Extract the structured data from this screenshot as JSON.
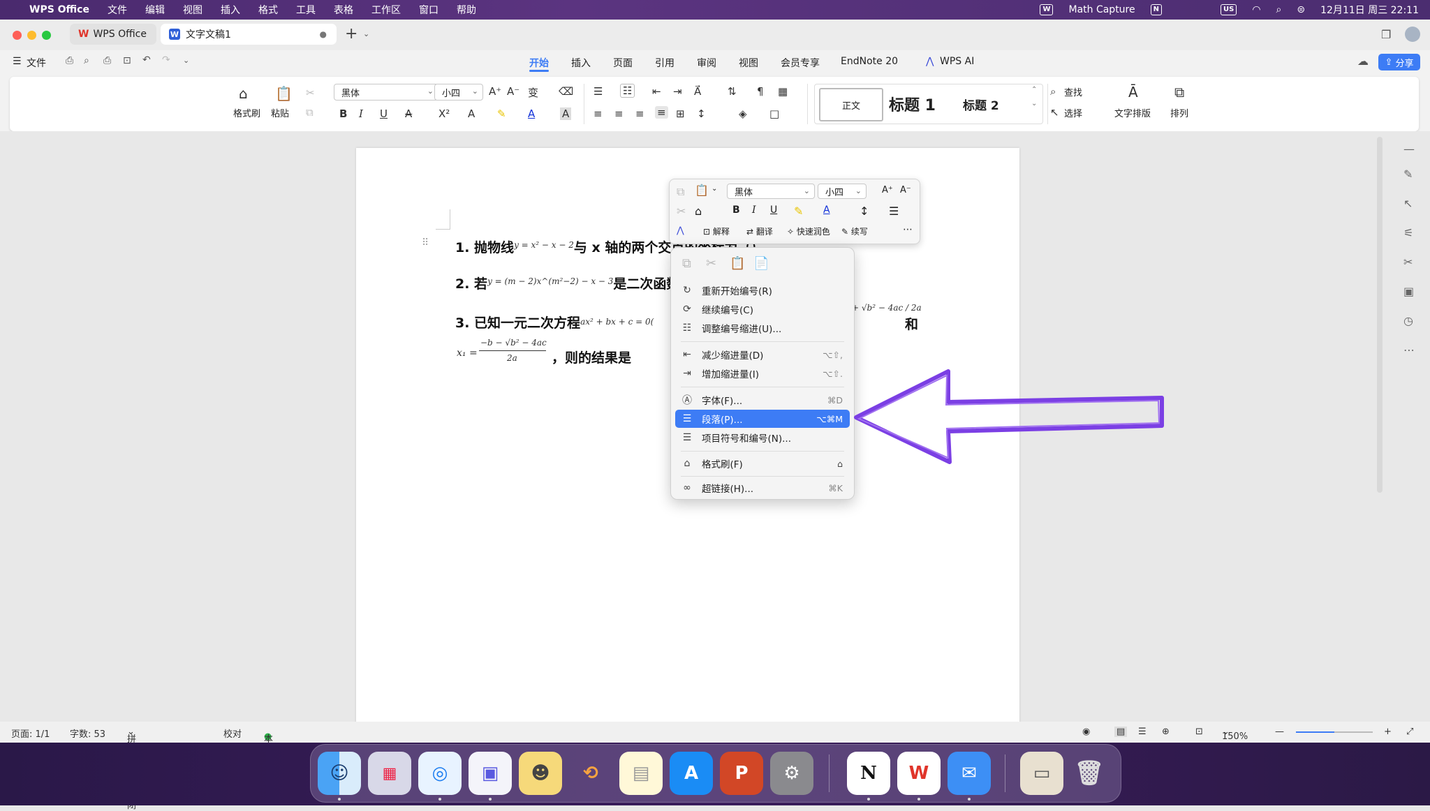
{
  "menubar": {
    "app": "WPS Office",
    "items": [
      "文件",
      "编辑",
      "视图",
      "插入",
      "格式",
      "工具",
      "表格",
      "工作区",
      "窗口",
      "帮助"
    ],
    "right": {
      "math_capture": "Math Capture",
      "input_badge": "US",
      "datetime": "12月11日 周三 22:11"
    }
  },
  "tabs": [
    {
      "label": "WPS Office"
    },
    {
      "label": "文字文稿1"
    }
  ],
  "toolbar": {
    "file_label": "文件"
  },
  "ribbon_tabs": [
    "开始",
    "插入",
    "页面",
    "引用",
    "审阅",
    "视图",
    "会员专享",
    "EndNote 20",
    "WPS AI"
  ],
  "share_label": "分享",
  "ribbon": {
    "format_painter": "格式刷",
    "paste": "粘贴",
    "font_name": "黑体",
    "font_size": "小四",
    "style_normal": "正文",
    "style_h1": "标题 1",
    "style_h2": "标题 2",
    "find": "查找",
    "select": "选择",
    "text_layout": "文字排版",
    "arrange": "排列"
  },
  "document": {
    "q1_prefix": "1.  抛物线",
    "q1_math": "y = x² − x − 2",
    "q1_suffix": "与 x 轴的两个交点的坐标为（）",
    "q2_prefix": "2.  若",
    "q2_math": "y = (m − 2)x^(m²−2) − x − 3",
    "q2_suffix": "是二次函数，",
    "q3_prefix": "3.  已知一元二次方程",
    "q3_math": "ax² + bx + c = 0(",
    "q3_frac": "+ √b² − 4ac / 2a",
    "q3_and": "和",
    "q3_x1": "x₁ =",
    "q3_x1_frac_top": "−b − √b² − 4ac",
    "q3_x1_frac_bot": "2a",
    "q3_suffix": "，则的结果是"
  },
  "mini_toolbar": {
    "font_name": "黑体",
    "font_size": "小四",
    "explain": "解释",
    "translate": "翻译",
    "quick_polish": "快速润色",
    "continue_write": "续写"
  },
  "context_menu": [
    {
      "label": "重新开始编号(R)",
      "shortcut": "",
      "icon": "restart-numbering-icon"
    },
    {
      "label": "继续编号(C)",
      "shortcut": "",
      "icon": "continue-numbering-icon"
    },
    {
      "label": "调整编号缩进(U)...",
      "shortcut": "",
      "icon": "adjust-indent-icon"
    },
    {
      "label": "减少缩进量(D)",
      "shortcut": "⌥⇧,",
      "icon": "decrease-indent-icon"
    },
    {
      "label": "增加缩进量(I)",
      "shortcut": "⌥⇧.",
      "icon": "increase-indent-icon"
    },
    {
      "label": "字体(F)...",
      "shortcut": "⌘D",
      "icon": "font-icon"
    },
    {
      "label": "段落(P)...",
      "shortcut": "⌥⌘M",
      "icon": "paragraph-icon",
      "highlighted": true
    },
    {
      "label": "项目符号和编号(N)...",
      "shortcut": "",
      "icon": "bullets-numbering-icon"
    },
    {
      "label": "格式刷(F)",
      "shortcut": "",
      "icon": "format-painter-icon"
    },
    {
      "label": "超链接(H)...",
      "shortcut": "⌘K",
      "icon": "hyperlink-icon"
    }
  ],
  "status": {
    "page": "页面: 1/1",
    "words": "字数: 53",
    "spell": "拼写检查: 关闭",
    "proof": "校对",
    "backup": "本地备份开",
    "zoom": "150%"
  },
  "colors": {
    "accent": "#3d7cf5",
    "annotation_arrow": "#7b3fe4",
    "wps_red": "#e0352b"
  }
}
